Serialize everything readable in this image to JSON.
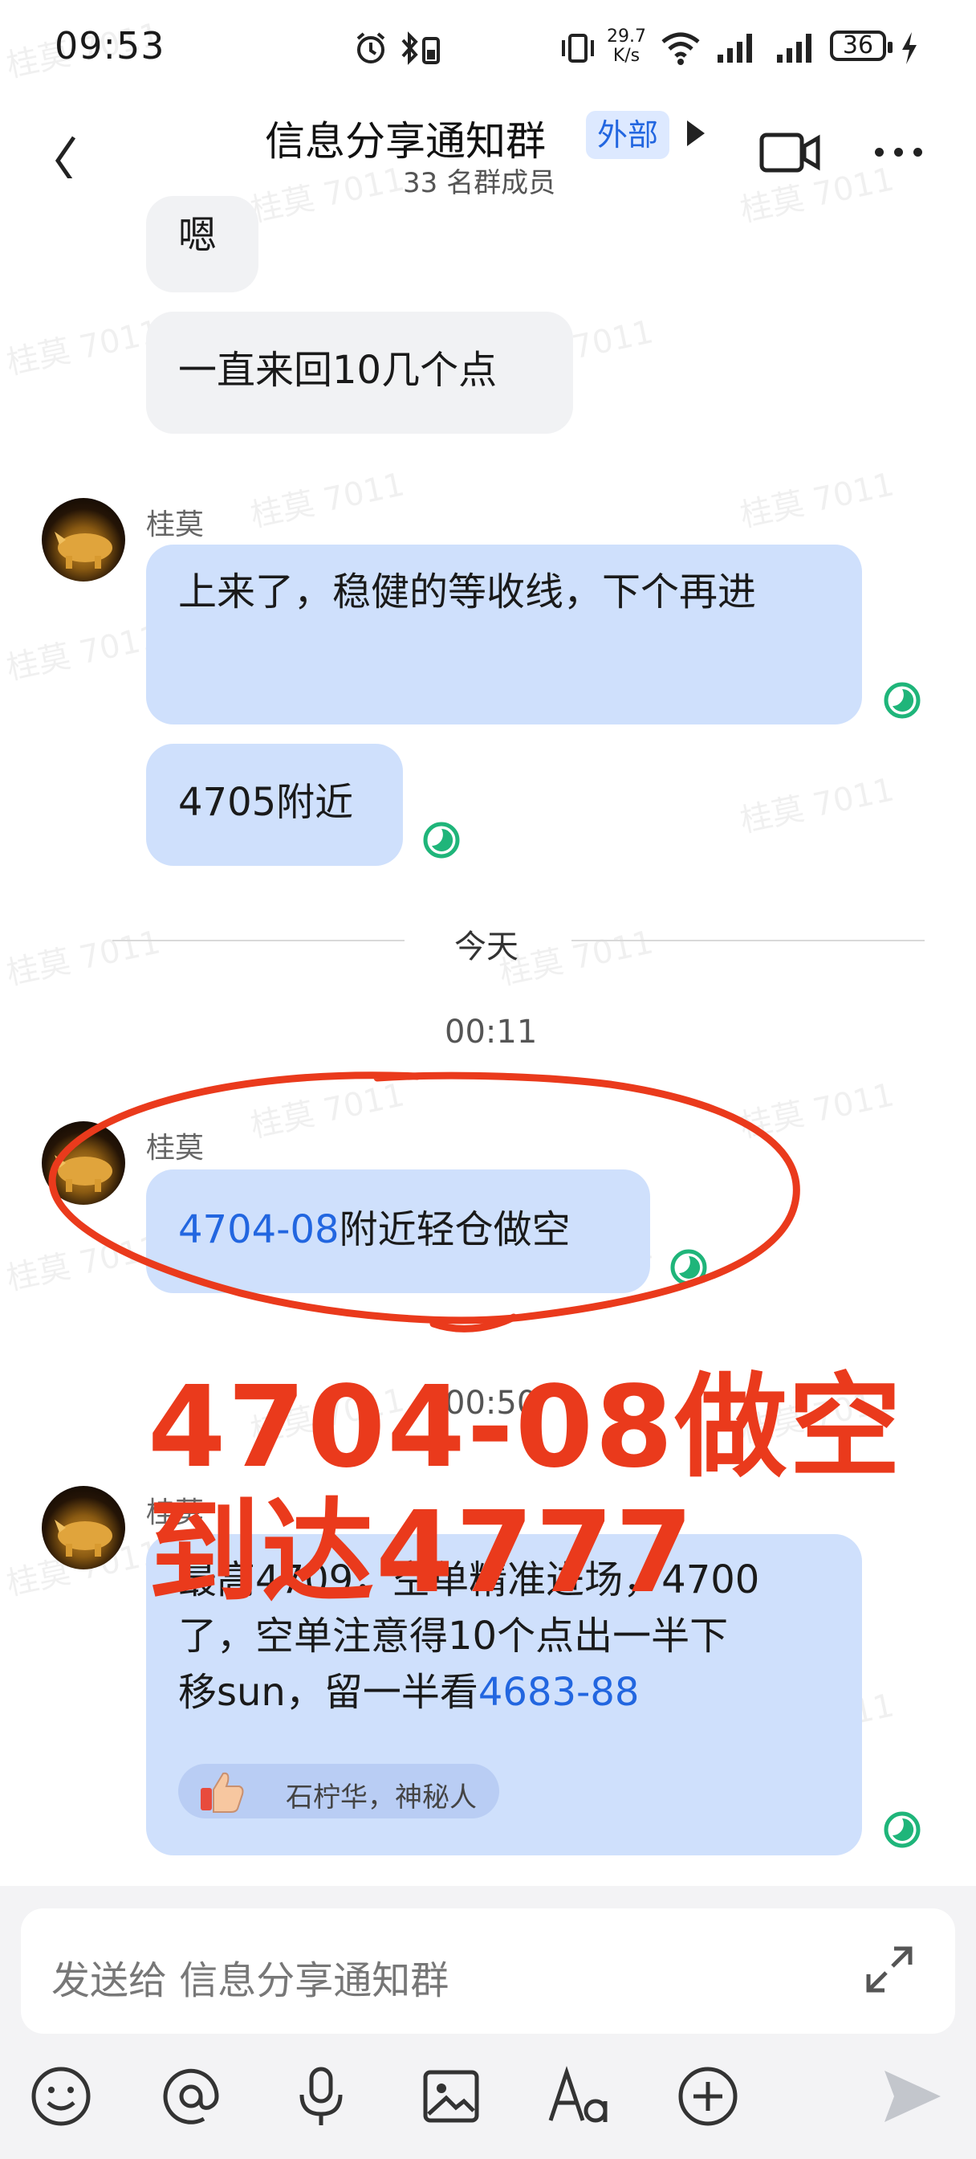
{
  "status_bar": {
    "time": "09:53",
    "net_speed_value": "29.7",
    "net_speed_unit": "K/s",
    "battery": "36"
  },
  "header": {
    "title": "信息分享通知群",
    "tag": "外部",
    "subtitle": "33 名群成员"
  },
  "messages": [
    {
      "text": "嗯"
    },
    {
      "text": "一直来回10几个点"
    },
    {
      "sender": "桂莫",
      "text": "上来了，稳健的等收线，下个再进"
    },
    {
      "text": "4705附近"
    }
  ],
  "date_separator": "今天",
  "time_stamp_1": "00:11",
  "msg5": {
    "sender": "桂莫",
    "link": "4704-08",
    "text": "附近轻仓做空"
  },
  "time_stamp_2": "00:50",
  "msg6": {
    "sender": "桂莫",
    "text_line1": "最高4709，空单精准进场，4700",
    "text_line2": "了，空单注意得10个点出一半下",
    "text_line3": "移sun，留一半看",
    "link": "4683-88",
    "reaction_users": "石柠华，神秘人"
  },
  "overlay": {
    "line1": "4704-08做空",
    "line2": "到达4777"
  },
  "input": {
    "placeholder": "发送给 信息分享通知群"
  },
  "watermark": "桂莫 7011",
  "colors": {
    "accent": "#2266e0",
    "bubble_blue": "#cfe0fc",
    "bubble_gray": "#f1f2f4",
    "annotation_red": "#ea3a1c",
    "read_green": "#1fb57a"
  }
}
